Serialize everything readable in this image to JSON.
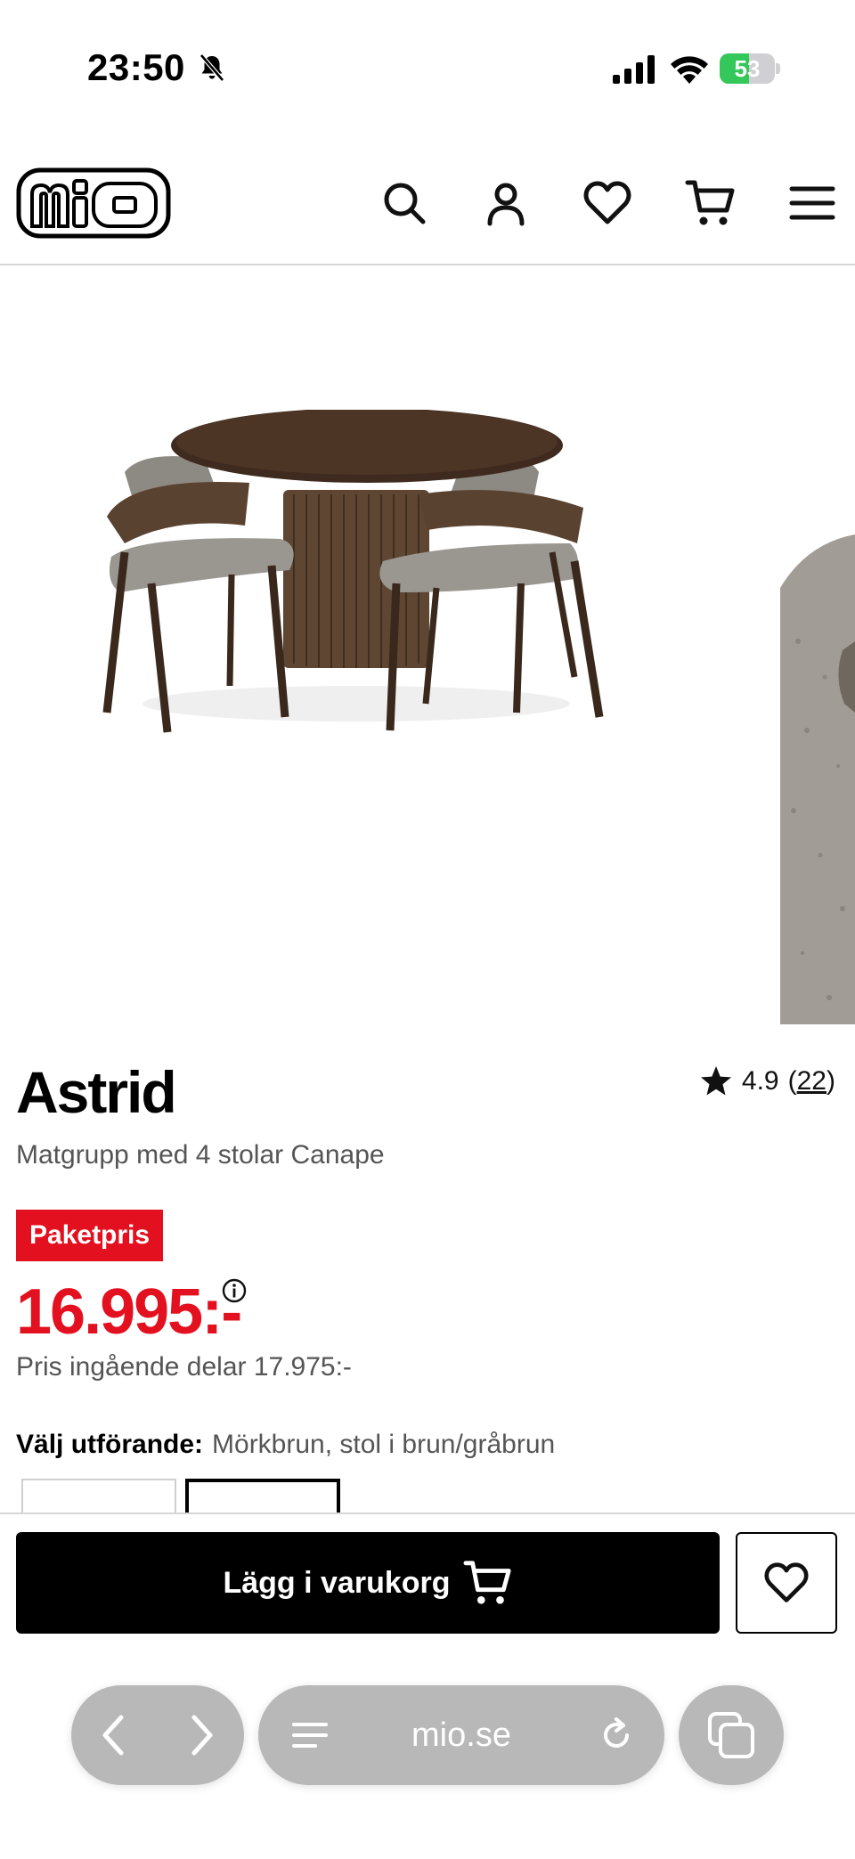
{
  "status_bar": {
    "time": "23:50",
    "battery_percent": "53",
    "battery_level": 0.53,
    "icons": [
      "bell-slash-icon",
      "cellular-signal-icon",
      "wifi-icon",
      "battery-charging-icon"
    ]
  },
  "header": {
    "logo_text": "mio",
    "icons": [
      "search-icon",
      "account-icon",
      "heart-icon",
      "cart-icon",
      "menu-icon"
    ]
  },
  "product": {
    "title": "Astrid",
    "rating": "4.9",
    "rating_open": "(",
    "review_count": "22",
    "rating_close": ")",
    "subtitle": "Matgrupp med 4 stolar Canape",
    "badge": "Paketpris",
    "price": "16.995:-",
    "parts_price": "Pris ingående delar 17.975:-",
    "variant_label": "Välj utförande:",
    "variant_value": "Mörkbrun, stol i brun/gråbrun"
  },
  "actions": {
    "add_to_cart": "Lägg i varukorg"
  },
  "browser": {
    "url": "mio.se"
  },
  "colors": {
    "accent_red": "#e3101f",
    "button_black": "#000000",
    "battery_green": "#34c759",
    "browser_pill": "#b8b8b8"
  }
}
